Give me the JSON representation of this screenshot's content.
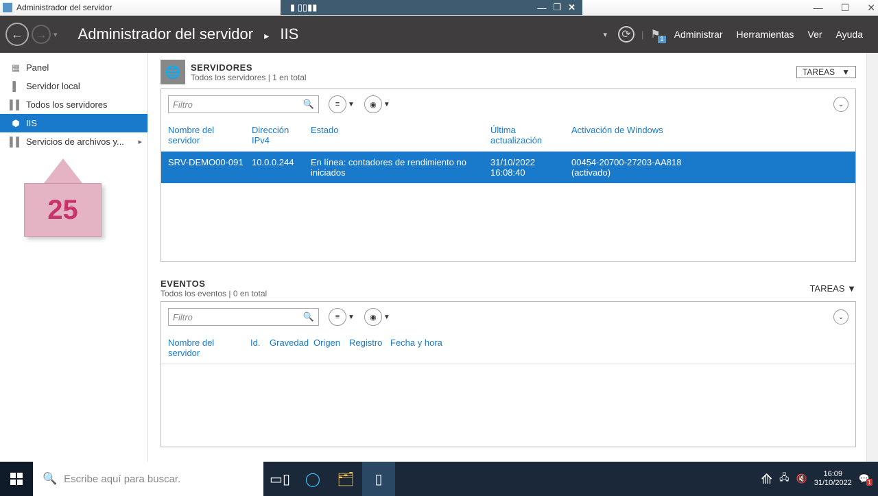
{
  "window": {
    "title": "Administrador del servidor"
  },
  "header": {
    "breadcrumb_root": "Administrador del servidor",
    "breadcrumb_leaf": "IIS",
    "menu": {
      "administrar": "Administrar",
      "herramientas": "Herramientas",
      "ver": "Ver",
      "ayuda": "Ayuda"
    },
    "flag_badge": "1"
  },
  "sidebar": {
    "items": [
      {
        "label": "Panel"
      },
      {
        "label": "Servidor local"
      },
      {
        "label": "Todos los servidores"
      },
      {
        "label": "IIS"
      },
      {
        "label": "Servicios de archivos y..."
      }
    ]
  },
  "annotation": {
    "number": "25"
  },
  "servers_section": {
    "title": "SERVIDORES",
    "subtitle": "Todos los servidores | 1 en total",
    "tasks_label": "TAREAS",
    "filter_placeholder": "Filtro",
    "columns": {
      "name": "Nombre del servidor",
      "ip": "Dirección IPv4",
      "status": "Estado",
      "last_update": "Última actualización",
      "activation": "Activación de Windows"
    },
    "rows": [
      {
        "name": "SRV-DEMO00-091",
        "ip": "10.0.0.244",
        "status": "En línea: contadores de rendimiento no iniciados",
        "last_update": "31/10/2022 16:08:40",
        "activation": "00454-20700-27203-AA818 (activado)"
      }
    ]
  },
  "events_section": {
    "title": "EVENTOS",
    "subtitle": "Todos los eventos | 0 en total",
    "tasks_label": "TAREAS",
    "filter_placeholder": "Filtro",
    "columns": {
      "name": "Nombre del servidor",
      "id": "Id.",
      "severity": "Gravedad",
      "origin": "Origen",
      "registry": "Registro",
      "datetime": "Fecha y hora"
    }
  },
  "taskbar": {
    "search_placeholder": "Escribe aquí para buscar.",
    "clock_time": "16:09",
    "clock_date": "31/10/2022",
    "notif_badge": "1"
  }
}
